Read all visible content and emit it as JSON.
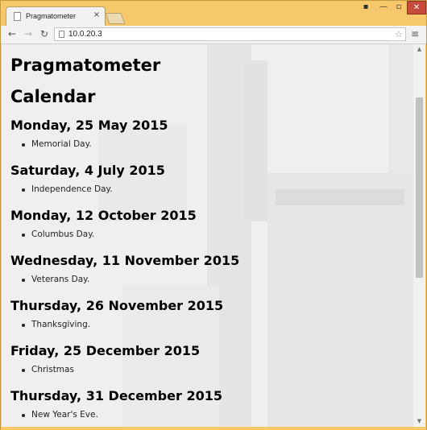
{
  "browser": {
    "tab_title": "Pragmatometer",
    "tab_close": "×",
    "address": "10.0.20.3"
  },
  "icons": {
    "tab_favicon": "page-icon",
    "back": "arrow-left-icon",
    "forward": "arrow-right-icon",
    "reload": "reload-icon",
    "star": "star-icon",
    "menu": "hamburger-menu-icon",
    "user": "user-icon",
    "minimize": "minimize-icon",
    "maximize": "maximize-icon",
    "close": "close-icon"
  },
  "glyphs": {
    "back": "←",
    "forward": "→",
    "reload": "↻",
    "star": "☆",
    "menu": "≡",
    "user": "▪",
    "minimize": "—",
    "maximize": "▫",
    "close": "✕",
    "scroll_up": "▲",
    "scroll_down": "▼"
  },
  "page": {
    "site_title": "Pragmatometer",
    "section_title": "Calendar",
    "events": [
      {
        "date": "Monday, 25 May 2015",
        "items": [
          "Memorial Day."
        ]
      },
      {
        "date": "Saturday, 4 July 2015",
        "items": [
          "Independence Day."
        ]
      },
      {
        "date": "Monday, 12 October 2015",
        "items": [
          "Columbus Day."
        ]
      },
      {
        "date": "Wednesday, 11 November 2015",
        "items": [
          "Veterans Day."
        ]
      },
      {
        "date": "Thursday, 26 November 2015",
        "items": [
          "Thanksgiving."
        ]
      },
      {
        "date": "Friday, 25 December 2015",
        "items": [
          "Christmas"
        ]
      },
      {
        "date": "Thursday, 31 December 2015",
        "items": [
          "New Year's Eve."
        ]
      }
    ]
  },
  "colors": {
    "window_frame": "#f6c86b",
    "close_button": "#c74a3a"
  }
}
